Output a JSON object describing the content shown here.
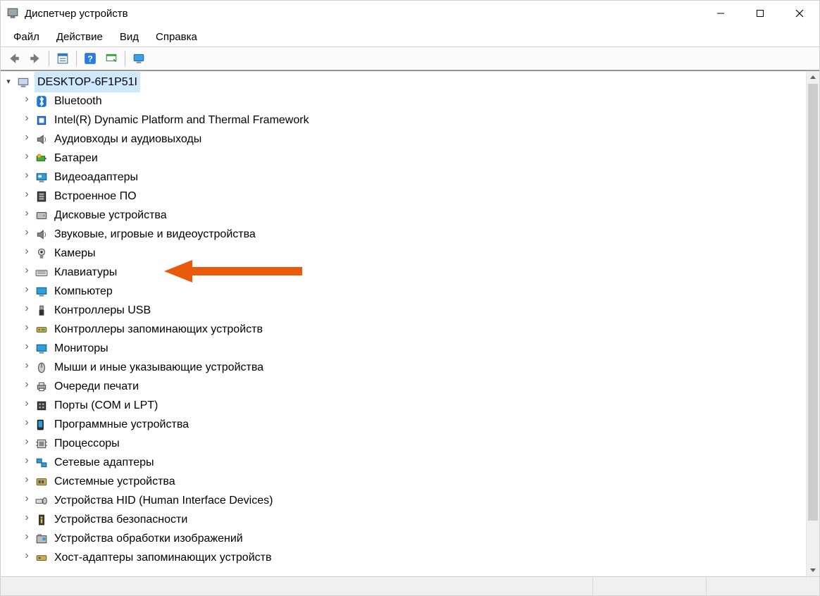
{
  "window": {
    "title": "Диспетчер устройств"
  },
  "menu": {
    "file": "Файл",
    "action": "Действие",
    "view": "Вид",
    "help": "Справка"
  },
  "toolbar_icons": {
    "back": "back-icon",
    "forward": "forward-icon",
    "properties": "properties-icon",
    "help": "help-icon",
    "scan": "scan-hardware-icon",
    "monitor": "show-hidden-icon"
  },
  "tree": {
    "root": "DESKTOP-6F1P51I",
    "items": [
      {
        "label": "Bluetooth",
        "icon": "bluetooth-icon"
      },
      {
        "label": "Intel(R) Dynamic Platform and Thermal Framework",
        "icon": "chip-icon"
      },
      {
        "label": "Аудиовходы и аудиовыходы",
        "icon": "speaker-icon"
      },
      {
        "label": "Батареи",
        "icon": "battery-icon"
      },
      {
        "label": "Видеоадаптеры",
        "icon": "display-adapter-icon"
      },
      {
        "label": "Встроенное ПО",
        "icon": "firmware-icon"
      },
      {
        "label": "Дисковые устройства",
        "icon": "disk-icon"
      },
      {
        "label": "Звуковые, игровые и видеоустройства",
        "icon": "sound-icon"
      },
      {
        "label": "Камеры",
        "icon": "camera-icon"
      },
      {
        "label": "Клавиатуры",
        "icon": "keyboard-icon"
      },
      {
        "label": "Компьютер",
        "icon": "computer-icon"
      },
      {
        "label": "Контроллеры USB",
        "icon": "usb-icon"
      },
      {
        "label": "Контроллеры запоминающих устройств",
        "icon": "storage-controller-icon"
      },
      {
        "label": "Мониторы",
        "icon": "monitor-icon"
      },
      {
        "label": "Мыши и иные указывающие устройства",
        "icon": "mouse-icon"
      },
      {
        "label": "Очереди печати",
        "icon": "printer-icon"
      },
      {
        "label": "Порты (COM и LPT)",
        "icon": "port-icon"
      },
      {
        "label": "Программные устройства",
        "icon": "software-device-icon"
      },
      {
        "label": "Процессоры",
        "icon": "cpu-icon"
      },
      {
        "label": "Сетевые адаптеры",
        "icon": "network-icon"
      },
      {
        "label": "Системные устройства",
        "icon": "system-icon"
      },
      {
        "label": "Устройства HID (Human Interface Devices)",
        "icon": "hid-icon"
      },
      {
        "label": "Устройства безопасности",
        "icon": "security-icon"
      },
      {
        "label": "Устройства обработки изображений",
        "icon": "imaging-icon"
      },
      {
        "label": "Хост-адаптеры запоминающих устройств",
        "icon": "host-adapter-icon"
      }
    ]
  },
  "annotation": {
    "arrow_color": "#ea5a0c",
    "target_index": 4
  }
}
